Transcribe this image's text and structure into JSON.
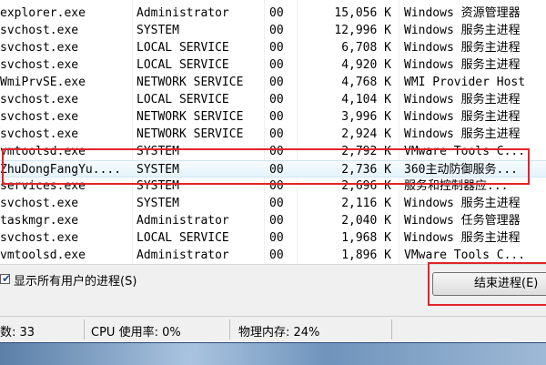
{
  "processes": [
    {
      "name": "explorer.exe",
      "user": "Administrator",
      "cpu": "00",
      "mem": "15,056 K",
      "desc": "Windows 资源管理器"
    },
    {
      "name": "svchost.exe",
      "user": "SYSTEM",
      "cpu": "00",
      "mem": "12,996 K",
      "desc": "Windows 服务主进程"
    },
    {
      "name": "svchost.exe",
      "user": "LOCAL SERVICE",
      "cpu": "00",
      "mem": "6,708 K",
      "desc": "Windows 服务主进程"
    },
    {
      "name": "svchost.exe",
      "user": "LOCAL SERVICE",
      "cpu": "00",
      "mem": "4,920 K",
      "desc": "Windows 服务主进程"
    },
    {
      "name": "WmiPrvSE.exe",
      "user": "NETWORK SERVICE",
      "cpu": "00",
      "mem": "4,768 K",
      "desc": "WMI Provider Host"
    },
    {
      "name": "svchost.exe",
      "user": "LOCAL SERVICE",
      "cpu": "00",
      "mem": "4,104 K",
      "desc": "Windows 服务主进程"
    },
    {
      "name": "svchost.exe",
      "user": "NETWORK SERVICE",
      "cpu": "00",
      "mem": "3,996 K",
      "desc": "Windows 服务主进程"
    },
    {
      "name": "svchost.exe",
      "user": "NETWORK SERVICE",
      "cpu": "00",
      "mem": "2,924 K",
      "desc": "Windows 服务主进程"
    },
    {
      "name": "vmtoolsd.exe",
      "user": "SYSTEM",
      "cpu": "00",
      "mem": "2,792 K",
      "desc": "VMware Tools C..."
    },
    {
      "name": "ZhuDongFangYu....",
      "user": "SYSTEM",
      "cpu": "00",
      "mem": "2,736 K",
      "desc": "360主动防御服务..."
    },
    {
      "name": "services.exe",
      "user": "SYSTEM",
      "cpu": "00",
      "mem": "2,696 K",
      "desc": "服务和控制器应..."
    },
    {
      "name": "svchost.exe",
      "user": "SYSTEM",
      "cpu": "00",
      "mem": "2,116 K",
      "desc": "Windows 服务主进程"
    },
    {
      "name": "taskmgr.exe",
      "user": "Administrator",
      "cpu": "00",
      "mem": "2,040 K",
      "desc": "Windows 任务管理器"
    },
    {
      "name": "svchost.exe",
      "user": "LOCAL SERVICE",
      "cpu": "00",
      "mem": "1,968 K",
      "desc": "Windows 服务主进程"
    },
    {
      "name": "vmtoolsd.exe",
      "user": "Administrator",
      "cpu": "00",
      "mem": "1,896 K",
      "desc": "VMware Tools C..."
    }
  ],
  "show_all_users_label": "显示所有用户的进程(S)",
  "end_process_label": "结束进程(E)",
  "status": {
    "process_count": "数: 33",
    "cpu_usage": "CPU 使用率: 0%",
    "memory": "物理内存: 24%"
  }
}
